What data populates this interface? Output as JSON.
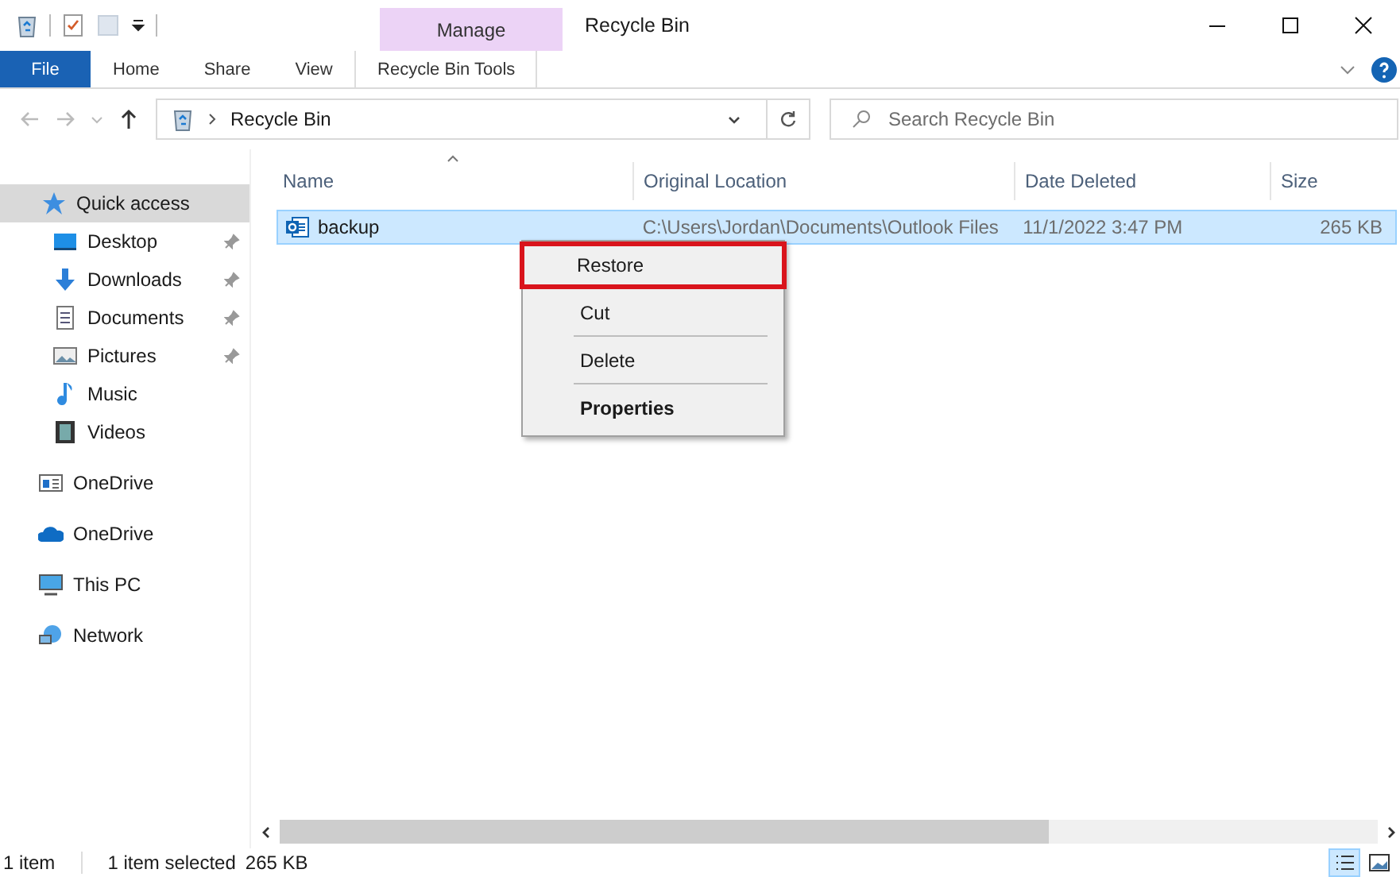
{
  "quick_toolbar": {
    "has_dropdown": true
  },
  "window": {
    "title": "Recycle Bin"
  },
  "contextual_tab": {
    "group": "Manage",
    "tab": "Recycle Bin Tools"
  },
  "ribbon_tabs": [
    {
      "label": "File",
      "kind": "file"
    },
    {
      "label": "Home",
      "kind": "tab"
    },
    {
      "label": "Share",
      "kind": "tab"
    },
    {
      "label": "View",
      "kind": "tab"
    }
  ],
  "address_bar": {
    "path": "Recycle Bin"
  },
  "search": {
    "placeholder": "Search Recycle Bin"
  },
  "sidebar": {
    "items": [
      {
        "label": "Quick access",
        "selected": true,
        "pinned": false,
        "indent": false
      },
      {
        "label": "Desktop",
        "selected": false,
        "pinned": true,
        "indent": true
      },
      {
        "label": "Downloads",
        "selected": false,
        "pinned": true,
        "indent": true
      },
      {
        "label": "Documents",
        "selected": false,
        "pinned": true,
        "indent": true
      },
      {
        "label": "Pictures",
        "selected": false,
        "pinned": true,
        "indent": true
      },
      {
        "label": "Music",
        "selected": false,
        "pinned": false,
        "indent": true
      },
      {
        "label": "Videos",
        "selected": false,
        "pinned": false,
        "indent": true
      },
      {
        "label": "OneDrive",
        "selected": false,
        "pinned": false,
        "indent": false
      },
      {
        "label": "OneDrive",
        "selected": false,
        "pinned": false,
        "indent": false
      },
      {
        "label": "This PC",
        "selected": false,
        "pinned": false,
        "indent": false
      },
      {
        "label": "Network",
        "selected": false,
        "pinned": false,
        "indent": false
      }
    ]
  },
  "table": {
    "columns": [
      "Name",
      "Original Location",
      "Date Deleted",
      "Size"
    ],
    "rows": [
      {
        "name": "backup",
        "location": "C:\\Users\\Jordan\\Documents\\Outlook Files",
        "date": "11/1/2022 3:47 PM",
        "size": "265 KB",
        "selected": true
      }
    ]
  },
  "context_menu": {
    "items": [
      {
        "kind": "item",
        "label": "Restore",
        "bold": false,
        "highlighted": true
      },
      {
        "kind": "item",
        "label": "Cut",
        "bold": false,
        "highlighted": false
      },
      {
        "kind": "separator"
      },
      {
        "kind": "item",
        "label": "Delete",
        "bold": false,
        "highlighted": false
      },
      {
        "kind": "separator"
      },
      {
        "kind": "item",
        "label": "Properties",
        "bold": true,
        "highlighted": false
      }
    ]
  },
  "status_bar": {
    "count": "1 item",
    "selection": "1 item selected",
    "size": "265 KB"
  }
}
